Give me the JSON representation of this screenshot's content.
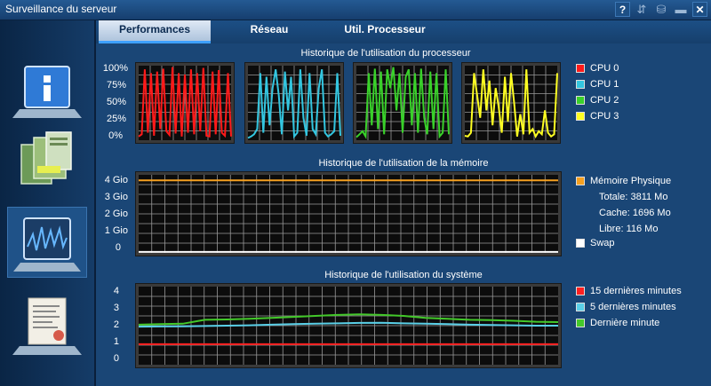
{
  "window": {
    "title": "Surveillance du serveur",
    "help_label": "?"
  },
  "colors": {
    "cpu0": "#ff1a1a",
    "cpu1": "#33c6e0",
    "cpu2": "#39d12a",
    "cpu3": "#ffff22",
    "memory": "#f5a020",
    "swap": "#ffffff",
    "load15": "#ff2020",
    "load5": "#5ad0e8",
    "load1": "#43c92a"
  },
  "sidebar": [
    {
      "name": "info",
      "icon": "info-icon"
    },
    {
      "name": "hardware",
      "icon": "server-icon"
    },
    {
      "name": "monitor",
      "icon": "monitor-chart-icon",
      "active": true
    },
    {
      "name": "log",
      "icon": "log-document-icon"
    }
  ],
  "tabs": [
    {
      "label": "Performances",
      "active": true
    },
    {
      "label": "Réseau",
      "active": false
    },
    {
      "label": "Util. Processeur",
      "active": false
    }
  ],
  "cpu": {
    "title": "Historique de l'utilisation du processeur",
    "y_ticks": [
      "100%",
      "75%",
      "50%",
      "25%",
      "0%"
    ],
    "legend": [
      "CPU 0",
      "CPU 1",
      "CPU 2",
      "CPU 3"
    ]
  },
  "memory": {
    "title": "Historique de l'utilisation de la mémoire",
    "y_ticks": [
      "4 Gio",
      "3 Gio",
      "2 Gio",
      "1 Gio",
      "0"
    ],
    "legend_physical": "Mémoire Physique",
    "total": "Totale: 3811 Mo",
    "cache": "Cache: 1696 Mo",
    "free": "Libre: 116 Mo",
    "legend_swap": "Swap"
  },
  "system": {
    "title": "Historique de l'utilisation du système",
    "y_ticks": [
      "4",
      "3",
      "2",
      "1",
      "0"
    ],
    "legend": [
      "15 dernières minutes",
      "5 dernières minutes",
      "Dernière minute"
    ]
  },
  "chart_data": [
    {
      "type": "line",
      "title": "Historique de l'utilisation du processeur",
      "ylim": [
        0,
        100
      ],
      "series": [
        {
          "name": "CPU 0",
          "values": [
            5,
            8,
            95,
            10,
            90,
            6,
            92,
            15,
            96,
            12,
            7,
            98,
            9,
            90,
            5,
            88,
            10,
            95,
            8,
            90,
            12,
            97,
            6,
            5,
            92,
            8,
            94,
            10,
            6,
            90,
            5
          ]
        },
        {
          "name": "CPU 1",
          "values": [
            3,
            5,
            8,
            15,
            90,
            10,
            85,
            20,
            70,
            95,
            60,
            8,
            92,
            40,
            85,
            5,
            10,
            95,
            30,
            6,
            90,
            15,
            8,
            70,
            95,
            10,
            5,
            8,
            12,
            90,
            6
          ]
        },
        {
          "name": "CPU 2",
          "values": [
            4,
            8,
            12,
            5,
            90,
            20,
            96,
            15,
            92,
            8,
            95,
            70,
            98,
            40,
            90,
            10,
            85,
            95,
            20,
            90,
            10,
            96,
            30,
            8,
            92,
            15,
            90,
            5,
            10,
            95,
            8
          ]
        },
        {
          "name": "CPU 3",
          "values": [
            6,
            5,
            10,
            90,
            60,
            30,
            95,
            40,
            80,
            20,
            70,
            45,
            10,
            85,
            25,
            90,
            50,
            5,
            35,
            8,
            95,
            10,
            15,
            5,
            12,
            8,
            40,
            10,
            5,
            8,
            90
          ]
        }
      ]
    },
    {
      "type": "line",
      "title": "Historique de l'utilisation de la mémoire",
      "ylim": [
        0,
        4
      ],
      "series": [
        {
          "name": "Mémoire Physique",
          "values": [
            3.72,
            3.72,
            3.72,
            3.72,
            3.72,
            3.72,
            3.72,
            3.72,
            3.72,
            3.72
          ]
        },
        {
          "name": "Swap",
          "values": [
            0.05,
            0.05,
            0.05,
            0.05,
            0.05,
            0.05,
            0.05,
            0.05,
            0.05,
            0.05
          ]
        }
      ]
    },
    {
      "type": "line",
      "title": "Historique de l'utilisation du système",
      "ylim": [
        0,
        4
      ],
      "series": [
        {
          "name": "15 dernières minutes",
          "values": [
            1.05,
            1.05,
            1.05,
            1.05,
            1.05,
            1.05,
            1.05,
            1.05,
            1.05,
            1.05,
            1.05,
            1.05,
            1.05,
            1.05,
            1.05,
            1.05,
            1.05,
            1.05,
            1.05,
            1.05
          ]
        },
        {
          "name": "5 dernières minutes",
          "values": [
            1.95,
            1.96,
            1.97,
            1.98,
            2.0,
            2.02,
            2.05,
            2.08,
            2.1,
            2.12,
            2.14,
            2.15,
            2.12,
            2.1,
            2.08,
            2.05,
            2.03,
            2.02,
            2.0,
            2.0
          ]
        },
        {
          "name": "Dernière minute",
          "values": [
            2.05,
            2.08,
            2.1,
            2.3,
            2.32,
            2.35,
            2.4,
            2.45,
            2.5,
            2.55,
            2.58,
            2.55,
            2.5,
            2.4,
            2.35,
            2.3,
            2.28,
            2.25,
            2.2,
            2.18
          ]
        }
      ]
    }
  ]
}
